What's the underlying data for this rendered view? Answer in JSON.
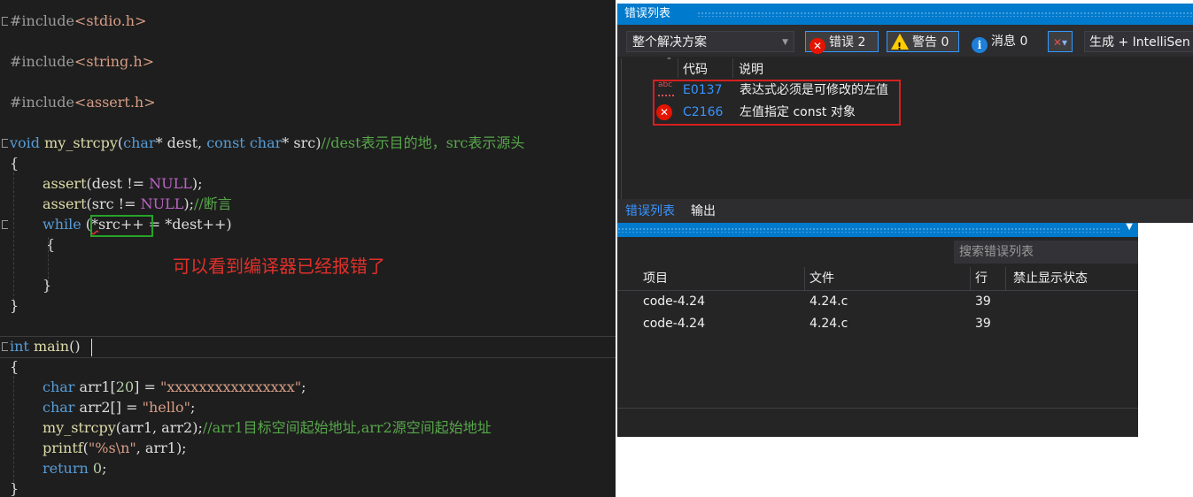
{
  "editor": {
    "lines": {
      "l1": {
        "hash": "#",
        "inc": "include",
        "file": "<stdio.h>"
      },
      "l2": {
        "hash": "#",
        "inc": "include",
        "file": "<string.h>"
      },
      "l3": {
        "hash": "#",
        "inc": "include",
        "file": "<assert.h>"
      },
      "l4": {
        "kw_void": "void",
        "fn": "my_strcpy",
        "p1": "(",
        "kw_char": "char",
        "p2": "* dest, ",
        "kw_const": "const",
        "kw_char2": "char",
        "p3": "* src)",
        "comment": "//dest表示目的地，src表示源头"
      },
      "l5": {
        "brace": "{"
      },
      "l6": {
        "fn": "assert",
        "p1": "(dest != ",
        "mac": "NULL",
        "p2": ");"
      },
      "l7": {
        "fn": "assert",
        "p1": "(src != ",
        "mac": "NULL",
        "p2": ");",
        "comment": "//断言"
      },
      "l8": {
        "kw": "while",
        "p1": " (",
        "err": "*",
        "p2": "src++ = *dest++)"
      },
      "l9": {
        "brace": "{"
      },
      "l10": {
        "brace": "}"
      },
      "l11": {
        "brace": "}"
      },
      "l12": {
        "kw": "int",
        "fn": "main",
        "p1": "()"
      },
      "l13": {
        "brace": "{"
      },
      "l14": {
        "kw": "char",
        "p1": " arr1[",
        "num": "20",
        "p2": "] = ",
        "str": "\"xxxxxxxxxxxxxxxx\"",
        "p3": ";"
      },
      "l15": {
        "kw": "char",
        "p1": " arr2[] = ",
        "str": "\"hello\"",
        "p2": ";"
      },
      "l16": {
        "fn": "my_strcpy",
        "p1": "(arr1, arr2);",
        "comment": "//arr1目标空间起始地址,arr2源空间起始地址"
      },
      "l17": {
        "fn": "printf",
        "p1": "(",
        "str": "\"%s\\n\"",
        "p2": ", arr1);"
      },
      "l18": {
        "kw": "return",
        "p1": " ",
        "num": "0",
        "p2": ";"
      },
      "l19": {
        "brace": "}"
      }
    },
    "annotation": "可以看到编译器已经报错了"
  },
  "error_list": {
    "title": "错误列表",
    "scope": "整个解决方案",
    "errors_label": "错误 2",
    "warnings_label": "警告 0",
    "messages_label": "消息 0",
    "build_filter": "生成 + IntelliSen",
    "columns": {
      "code": "代码",
      "description": "说明"
    },
    "rows": [
      {
        "code": "E0137",
        "description": "表达式必须是可修改的左值",
        "icon": "intellisense-error-icon"
      },
      {
        "code": "C2166",
        "description": "左值指定 const 对象",
        "icon": "error-icon"
      }
    ],
    "tabs": {
      "error_list": "错误列表",
      "output": "输出"
    }
  },
  "detail_panel": {
    "search_placeholder": "搜索错误列表",
    "columns": {
      "project": "项目",
      "file": "文件",
      "line": "行",
      "suppression": "禁止显示状态"
    },
    "rows": [
      {
        "project": "code-4.24",
        "file": "4.24.c",
        "line": "39"
      },
      {
        "project": "code-4.24",
        "file": "4.24.c",
        "line": "39"
      }
    ]
  },
  "colors": {
    "accent": "#007acc",
    "error": "#e51400",
    "annotation": "#e0302a",
    "highlight_box": "#27a327"
  }
}
